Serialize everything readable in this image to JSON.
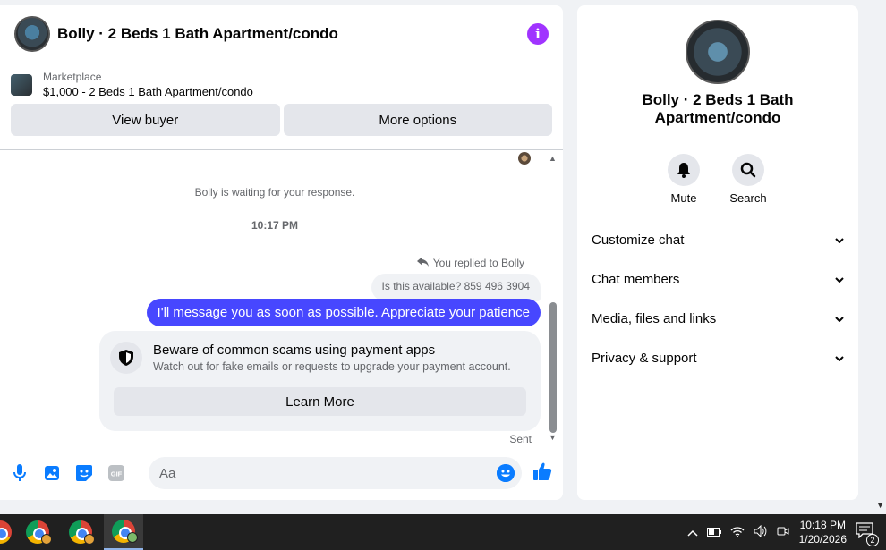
{
  "chat": {
    "title": "Bolly · 2 Beds 1 Bath Apartment/condo",
    "listing_label": "Marketplace",
    "listing_desc": "$1,000 - 2 Beds 1 Bath Apartment/condo",
    "view_buyer_label": "View buyer",
    "more_options_label": "More options",
    "waiting_text": "Bolly is waiting for your response.",
    "timestamp": "10:17 PM",
    "replied_text": "You replied to Bolly",
    "quoted_text": "Is this available? 859 496 3904",
    "sent_message": "I'll message you as soon as possible. Appreciate your patience",
    "scam_title": "Beware of common scams using payment apps",
    "scam_subtitle": "Watch out for fake emails or requests to upgrade your payment account.",
    "learn_more_label": "Learn More",
    "sent_status": "Sent",
    "input_placeholder": "Aa"
  },
  "info_panel": {
    "title": "Bolly · 2 Beds 1 Bath Apartment/condo",
    "actions": [
      {
        "label": "Mute",
        "icon": "bell-icon"
      },
      {
        "label": "Search",
        "icon": "search-icon"
      }
    ],
    "menu": [
      {
        "label": "Customize chat"
      },
      {
        "label": "Chat members"
      },
      {
        "label": "Media, files and links"
      },
      {
        "label": "Privacy & support"
      }
    ]
  },
  "taskbar": {
    "time": "10:18 PM",
    "date": "1/20/2026",
    "notification_count": "2"
  },
  "colors": {
    "accent_blue": "#0a7cff",
    "bubble": "#4747ff",
    "info_purple": "#a033ff"
  }
}
